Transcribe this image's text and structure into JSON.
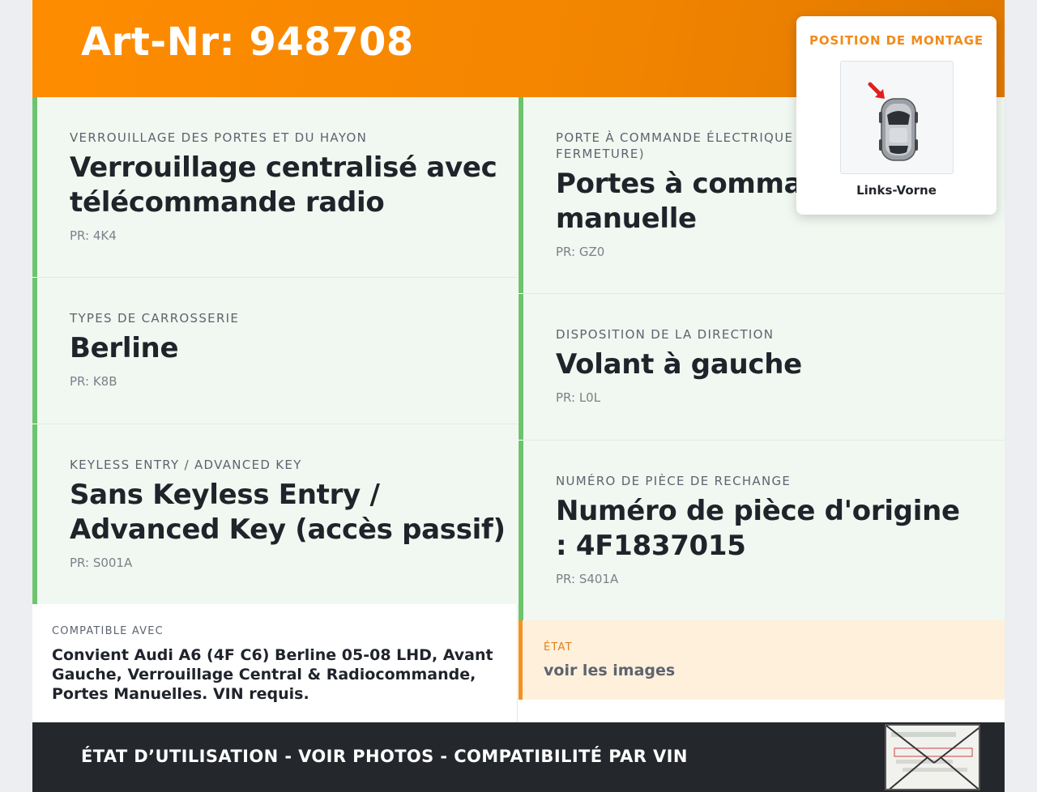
{
  "header": {
    "title": "Art-Nr: 948708"
  },
  "specs": [
    {
      "label": "VERROUILLAGE DES PORTES ET DU HAYON",
      "value": "Verrouillage centralisé avec télécommande radio",
      "pr": "PR: 4K4"
    },
    {
      "label": "PORTE À COMMANDE ÉLECTRIQUE (OUVERTURE/ FERMETURE)",
      "value": "Portes à commande manuelle",
      "pr": "PR: GZ0"
    },
    {
      "label": "TYPES DE CARROSSERIE",
      "value": "Berline",
      "pr": "PR: K8B"
    },
    {
      "label": "DISPOSITION DE LA DIRECTION",
      "value": "Volant à gauche",
      "pr": "PR: L0L"
    },
    {
      "label": "KEYLESS ENTRY / ADVANCED KEY",
      "value": "Sans Keyless Entry / Advanced Key (accès passif)",
      "pr": "PR: S001A"
    },
    {
      "label": "NUMÉRO DE PIÈCE DE RECHANGE",
      "value": "Numéro de pièce d'origine : 4F1837015",
      "pr": "PR: S401A"
    }
  ],
  "compat": {
    "label": "COMPATIBLE AVEC",
    "text": "Convient Audi A6 (4F C6) Berline 05-08 LHD, Avant Gauche, Verrouillage Central & Radiocommande, Portes Manuelles. VIN requis."
  },
  "etat": {
    "label": "ÉTAT",
    "text": "voir les images"
  },
  "footer": {
    "text": "ÉTAT D’UTILISATION - VOIR PHOTOS - COMPATIBILITÉ PAR VIN"
  },
  "popup": {
    "title": "POSITION DE MONTAGE",
    "caption": "Links-Vorne"
  },
  "colors": {
    "accent": "#f28500",
    "green_border": "#6cc46c",
    "cell_bg": "#f1f8f1",
    "etat_bg": "#fff0dc",
    "footer_bg": "#24272c"
  },
  "icons": {
    "position_diagram": "car-top-view-with-arrow-icon",
    "plate": "registration-document-thumbnail"
  }
}
